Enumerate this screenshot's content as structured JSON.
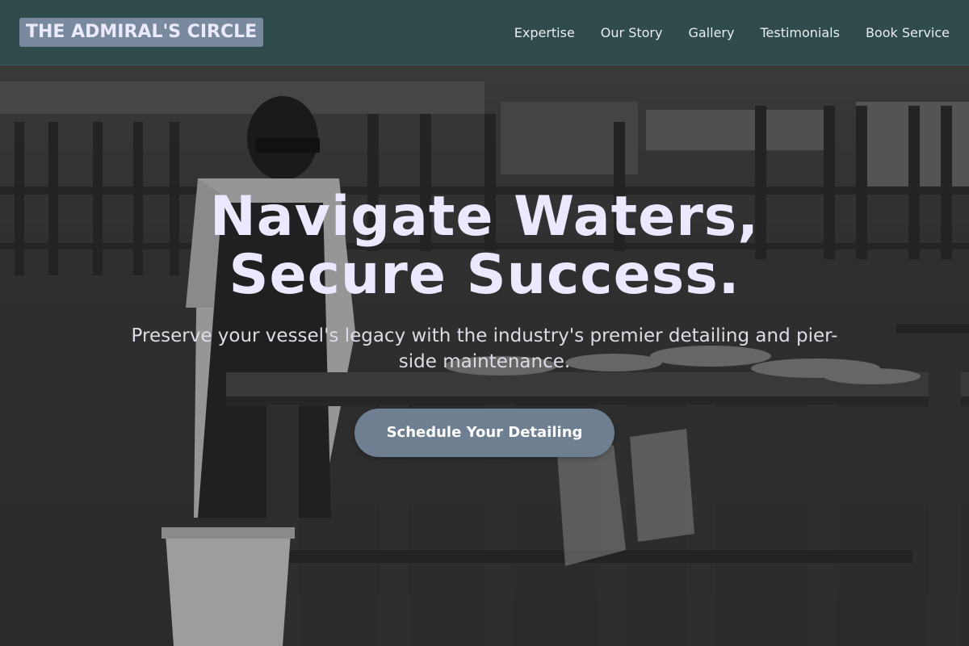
{
  "header": {
    "brand": "THE ADMIRAL'S CIRCLE",
    "nav": [
      {
        "label": "Expertise"
      },
      {
        "label": "Our Story"
      },
      {
        "label": "Gallery"
      },
      {
        "label": "Testimonials"
      },
      {
        "label": "Book Service"
      }
    ]
  },
  "hero": {
    "headline_line1": "Navigate Waters,",
    "headline_line2": "Secure Success.",
    "subheadline": "Preserve your vessel's legacy with the industry's premier detailing and pier-side maintenance.",
    "cta_label": "Schedule Your Detailing",
    "background_photo": "grayscale photo of a fisherman cleaning fish at a wooden table on a pier",
    "background_alt_text": "custom boats"
  },
  "colors": {
    "header_bg": "#2f4b4b",
    "brand_bg": "#7a8a9e",
    "headline_text": "#ebe8ff",
    "cta_bg": "#6e7f92"
  }
}
